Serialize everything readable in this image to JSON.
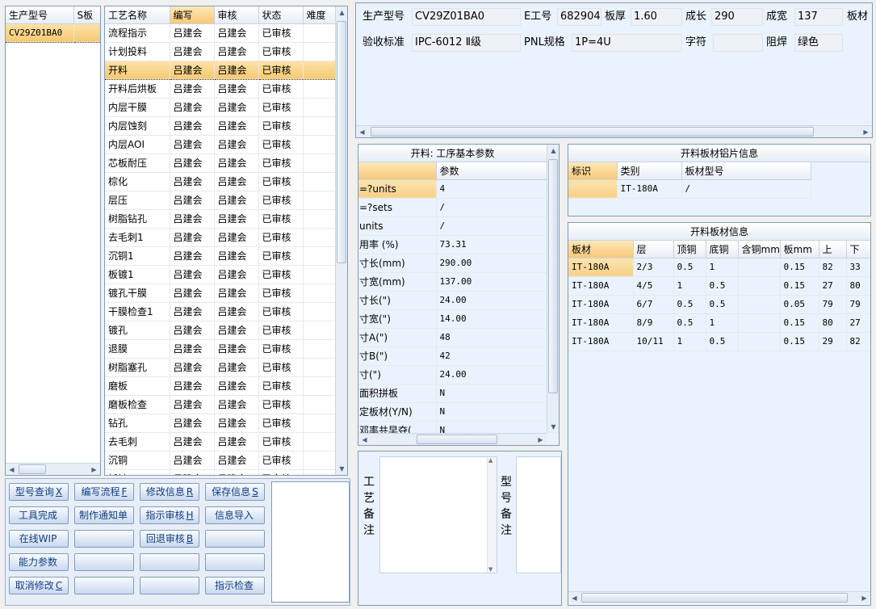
{
  "left_list": {
    "headers": [
      "生产型号",
      "S板"
    ],
    "items": [
      "CV29Z01BA0"
    ]
  },
  "process_table": {
    "headers": [
      "工艺名称",
      "编写",
      "审核",
      "状态",
      "难度"
    ],
    "rows": [
      [
        "流程指示",
        "吕建会",
        "吕建会",
        "已审核",
        ""
      ],
      [
        "计划投料",
        "吕建会",
        "吕建会",
        "已审核",
        ""
      ],
      [
        "开料",
        "吕建会",
        "吕建会",
        "已审核",
        ""
      ],
      [
        "开料后烘板",
        "吕建会",
        "吕建会",
        "已审核",
        ""
      ],
      [
        "内层干膜",
        "吕建会",
        "吕建会",
        "已审核",
        ""
      ],
      [
        "内层蚀刻",
        "吕建会",
        "吕建会",
        "已审核",
        ""
      ],
      [
        "内层AOI",
        "吕建会",
        "吕建会",
        "已审核",
        ""
      ],
      [
        "芯板耐压",
        "吕建会",
        "吕建会",
        "已审核",
        ""
      ],
      [
        "棕化",
        "吕建会",
        "吕建会",
        "已审核",
        ""
      ],
      [
        "层压",
        "吕建会",
        "吕建会",
        "已审核",
        ""
      ],
      [
        "树脂钻孔",
        "吕建会",
        "吕建会",
        "已审核",
        ""
      ],
      [
        "去毛刺1",
        "吕建会",
        "吕建会",
        "已审核",
        ""
      ],
      [
        "沉铜1",
        "吕建会",
        "吕建会",
        "已审核",
        ""
      ],
      [
        "板镀1",
        "吕建会",
        "吕建会",
        "已审核",
        ""
      ],
      [
        "镀孔干膜",
        "吕建会",
        "吕建会",
        "已审核",
        ""
      ],
      [
        "干膜检查1",
        "吕建会",
        "吕建会",
        "已审核",
        ""
      ],
      [
        "镀孔",
        "吕建会",
        "吕建会",
        "已审核",
        ""
      ],
      [
        "退膜",
        "吕建会",
        "吕建会",
        "已审核",
        ""
      ],
      [
        "树脂塞孔",
        "吕建会",
        "吕建会",
        "已审核",
        ""
      ],
      [
        "磨板",
        "吕建会",
        "吕建会",
        "已审核",
        ""
      ],
      [
        "磨板检查",
        "吕建会",
        "吕建会",
        "已审核",
        ""
      ],
      [
        "钻孔",
        "吕建会",
        "吕建会",
        "已审核",
        ""
      ],
      [
        "去毛刺",
        "吕建会",
        "吕建会",
        "已审核",
        ""
      ],
      [
        "沉铜",
        "吕建会",
        "吕建会",
        "已审核",
        ""
      ],
      [
        "板镀",
        "吕建会",
        "吕建会",
        "已审核",
        ""
      ]
    ],
    "selected_index": 2
  },
  "buttons": [
    {
      "text": "型号查询",
      "key": "X"
    },
    {
      "text": "编写流程",
      "key": "F"
    },
    {
      "text": "修改信息",
      "key": "R"
    },
    {
      "text": "保存信息",
      "key": "S"
    },
    {
      "text": "工具完成",
      "key": ""
    },
    {
      "text": "制作通知单",
      "key": ""
    },
    {
      "text": "指示审核",
      "key": "H"
    },
    {
      "text": "信息导入",
      "key": ""
    },
    {
      "text": "在线WIP",
      "key": ""
    },
    {
      "text": "",
      "key": ""
    },
    {
      "text": "回退审核",
      "key": "B"
    },
    {
      "text": "",
      "key": ""
    },
    {
      "text": "能力参数",
      "key": ""
    },
    {
      "text": "",
      "key": ""
    },
    {
      "text": "",
      "key": ""
    },
    {
      "text": "",
      "key": ""
    },
    {
      "text": "取消修改",
      "key": "C"
    },
    {
      "text": "",
      "key": ""
    },
    {
      "text": "",
      "key": ""
    },
    {
      "text": "指示检查",
      "key": ""
    }
  ],
  "info": {
    "model_label": "生产型号",
    "model_value": "CV29Z01BA0",
    "eno_label": "E工号",
    "eno_value": "682904",
    "thick_label": "板厚",
    "thick_value": "1.60",
    "length_label": "成长",
    "length_value": "290",
    "width_label": "成宽",
    "width_value": "137",
    "material_label": "板材",
    "accept_label": "验收标准",
    "accept_value": "IPC-6012 Ⅱ级",
    "pnl_label": "PNL规格",
    "pnl_value": "1P=4U",
    "char_label": "字符",
    "char_value": "",
    "mask_label": "阻焊",
    "mask_value": "绿色"
  },
  "params": {
    "title": "开料: 工序基本参数",
    "header": "参数",
    "rows": [
      [
        "=?units",
        "4"
      ],
      [
        "=?sets",
        "/"
      ],
      [
        "units",
        "/"
      ],
      [
        "用率 (%)",
        "73.31"
      ],
      [
        "寸长(mm)",
        "290.00"
      ],
      [
        "寸宽(mm)",
        "137.00"
      ],
      [
        "寸长(\")",
        "24.00"
      ],
      [
        "寸宽(\")",
        "14.00"
      ],
      [
        "寸A(\")",
        "48"
      ],
      [
        "寸B(\")",
        "42"
      ],
      [
        "寸(\")",
        "24.00"
      ],
      [
        "面积拼板",
        "N"
      ],
      [
        "定板材(Y/N)",
        "N"
      ],
      [
        "邓率共早夺(",
        "N"
      ]
    ]
  },
  "alu": {
    "title": "开料板材铝片信息",
    "headers": [
      "标识",
      "类别",
      "板材型号"
    ],
    "rows": [
      [
        "",
        "IT-180A",
        "/"
      ]
    ]
  },
  "board": {
    "title": "开料板材信息",
    "headers": [
      "板材",
      "层",
      "顶铜",
      "底铜",
      "含铜mm",
      "板mm",
      "上",
      "下"
    ],
    "rows": [
      [
        "IT-180A",
        "2/3",
        "0.5",
        "1",
        "",
        "0.15",
        "82",
        "33"
      ],
      [
        "IT-180A",
        "4/5",
        "1",
        "0.5",
        "",
        "0.15",
        "27",
        "80"
      ],
      [
        "IT-180A",
        "6/7",
        "0.5",
        "0.5",
        "",
        "0.05",
        "79",
        "79"
      ],
      [
        "IT-180A",
        "8/9",
        "0.5",
        "1",
        "",
        "0.15",
        "80",
        "27"
      ],
      [
        "IT-180A",
        "10/11",
        "1",
        "0.5",
        "",
        "0.15",
        "29",
        "82"
      ]
    ]
  },
  "notes": {
    "craft_label": "工艺备注",
    "model_label": "型号备注"
  },
  "colors": {
    "accent": "#f7cf87",
    "border": "#7f9db9",
    "panel_bg": "#eaf3fd",
    "button_text": "#123d80"
  }
}
